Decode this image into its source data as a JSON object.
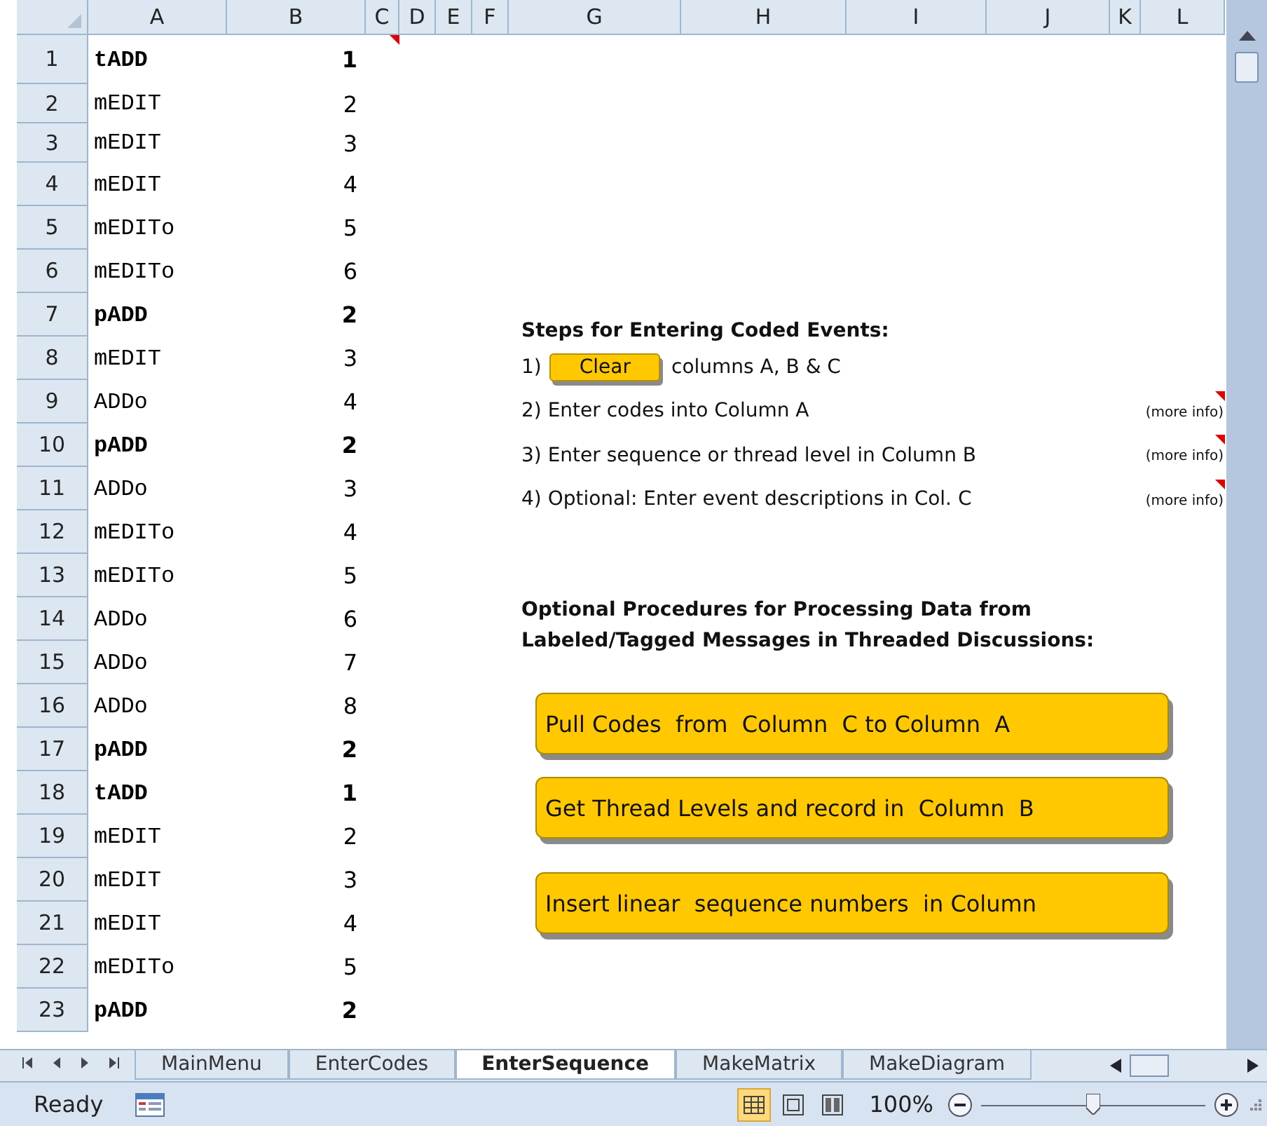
{
  "columns": [
    "A",
    "B",
    "C",
    "D",
    "E",
    "F",
    "G",
    "H",
    "I",
    "J",
    "K",
    "L"
  ],
  "rows": [
    {
      "number": "1",
      "code": "tADD",
      "level": "1",
      "bold": true,
      "comment": true
    },
    {
      "number": "2",
      "code": "mEDIT",
      "level": "2",
      "bold": false,
      "comment": false
    },
    {
      "number": "3",
      "code": "mEDIT",
      "level": "3",
      "bold": false,
      "comment": false
    },
    {
      "number": "4",
      "code": "mEDIT",
      "level": "4",
      "bold": false,
      "comment": false
    },
    {
      "number": "5",
      "code": "mEDITo",
      "level": "5",
      "bold": false,
      "comment": false
    },
    {
      "number": "6",
      "code": "mEDITo",
      "level": "6",
      "bold": false,
      "comment": false
    },
    {
      "number": "7",
      "code": "pADD",
      "level": "2",
      "bold": true,
      "comment": false
    },
    {
      "number": "8",
      "code": "mEDIT",
      "level": "3",
      "bold": false,
      "comment": false
    },
    {
      "number": "9",
      "code": "ADDo",
      "level": "4",
      "bold": false,
      "comment": false
    },
    {
      "number": "10",
      "code": "pADD",
      "level": "2",
      "bold": true,
      "comment": false
    },
    {
      "number": "11",
      "code": "ADDo",
      "level": "3",
      "bold": false,
      "comment": false
    },
    {
      "number": "12",
      "code": "mEDITo",
      "level": "4",
      "bold": false,
      "comment": false
    },
    {
      "number": "13",
      "code": "mEDITo",
      "level": "5",
      "bold": false,
      "comment": false
    },
    {
      "number": "14",
      "code": "ADDo",
      "level": "6",
      "bold": false,
      "comment": false
    },
    {
      "number": "15",
      "code": "ADDo",
      "level": "7",
      "bold": false,
      "comment": false
    },
    {
      "number": "16",
      "code": "ADDo",
      "level": "8",
      "bold": false,
      "comment": false
    },
    {
      "number": "17",
      "code": "pADD",
      "level": "2",
      "bold": true,
      "comment": false
    },
    {
      "number": "18",
      "code": "tADD",
      "level": "1",
      "bold": true,
      "comment": false
    },
    {
      "number": "19",
      "code": "mEDIT",
      "level": "2",
      "bold": false,
      "comment": false
    },
    {
      "number": "20",
      "code": "mEDIT",
      "level": "3",
      "bold": false,
      "comment": false
    },
    {
      "number": "21",
      "code": "mEDIT",
      "level": "4",
      "bold": false,
      "comment": false
    },
    {
      "number": "22",
      "code": "mEDITo",
      "level": "5",
      "bold": false,
      "comment": false
    },
    {
      "number": "23",
      "code": "pADD",
      "level": "2",
      "bold": true,
      "comment": false
    }
  ],
  "steps_title": "Steps for Entering Coded Events:",
  "steps": [
    {
      "kind": "button",
      "prefix": "1)",
      "button": "Clear",
      "text": "columns A, B & C"
    },
    {
      "kind": "note",
      "text": "2) Enter codes into Column A",
      "note": "(more info)"
    },
    {
      "kind": "note",
      "text": "3) Enter sequence or thread level in Column B",
      "note": "(more info)"
    },
    {
      "kind": "note",
      "text": "4) Optional: Enter event descriptions in Col. C",
      "note": "(more info)"
    }
  ],
  "procedures_title": "Optional Procedures for Processing Data from Labeled/Tagged Messages in Threaded Discussions:",
  "procedure_buttons": [
    "Pull Codes  from  Column  C to Column  A",
    "Get Thread Levels and record in  Column  B",
    "Insert linear  sequence numbers  in Column"
  ],
  "sheet_tabs": [
    {
      "label": "MainMenu",
      "selected": false
    },
    {
      "label": "EnterCodes",
      "selected": false
    },
    {
      "label": "EnterSequence",
      "selected": true
    },
    {
      "label": "MakeMatrix",
      "selected": false
    },
    {
      "label": "MakeDiagram",
      "selected": false
    }
  ],
  "status_bar": {
    "status": "Ready",
    "views": [
      {
        "selected": true
      },
      {
        "selected": false
      },
      {
        "selected": false
      }
    ],
    "zoom": "100%",
    "zoom_slider": {
      "level": 0.5
    }
  }
}
